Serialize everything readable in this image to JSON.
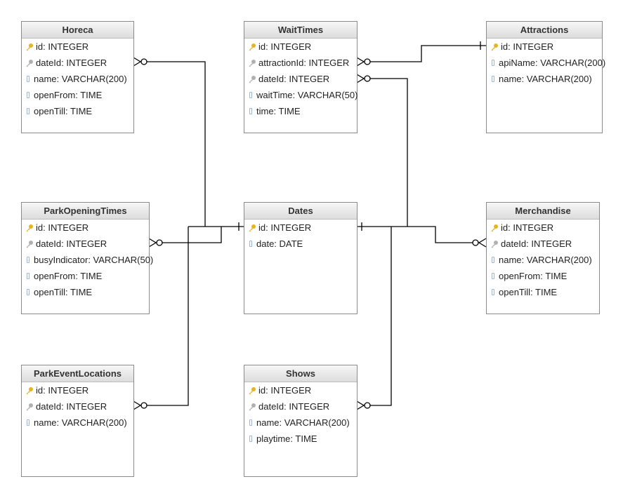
{
  "icons": {
    "pk": "primary-key-icon",
    "fk": "foreign-key-icon",
    "col": "column-icon"
  },
  "colors": {
    "pk": "#e6b422",
    "fk": "#b0b0b0",
    "col": "#9bb7d6",
    "line": "#000000"
  },
  "tables": [
    {
      "id": "horeca",
      "name": "Horeca",
      "fields": [
        {
          "icon": "pk",
          "text": "id: INTEGER"
        },
        {
          "icon": "fk",
          "text": "dateId: INTEGER"
        },
        {
          "icon": "col",
          "text": "name: VARCHAR(200)"
        },
        {
          "icon": "col",
          "text": "openFrom: TIME"
        },
        {
          "icon": "col",
          "text": "openTill: TIME"
        }
      ]
    },
    {
      "id": "waittimes",
      "name": "WaitTimes",
      "fields": [
        {
          "icon": "pk",
          "text": "id: INTEGER"
        },
        {
          "icon": "fk",
          "text": "attractionId: INTEGER"
        },
        {
          "icon": "fk",
          "text": "dateId: INTEGER"
        },
        {
          "icon": "col",
          "text": "waitTime: VARCHAR(50)"
        },
        {
          "icon": "col",
          "text": "time: TIME"
        }
      ]
    },
    {
      "id": "attractions",
      "name": "Attractions",
      "fields": [
        {
          "icon": "pk",
          "text": "id: INTEGER"
        },
        {
          "icon": "col",
          "text": "apiName: VARCHAR(200)"
        },
        {
          "icon": "col",
          "text": "name: VARCHAR(200)"
        }
      ]
    },
    {
      "id": "parkopeningtimes",
      "name": "ParkOpeningTimes",
      "fields": [
        {
          "icon": "pk",
          "text": "id: INTEGER"
        },
        {
          "icon": "fk",
          "text": "dateId: INTEGER"
        },
        {
          "icon": "col",
          "text": "busyIndicator: VARCHAR(50)"
        },
        {
          "icon": "col",
          "text": "openFrom: TIME"
        },
        {
          "icon": "col",
          "text": "openTill: TIME"
        }
      ]
    },
    {
      "id": "dates",
      "name": "Dates",
      "fields": [
        {
          "icon": "pk",
          "text": "id: INTEGER"
        },
        {
          "icon": "col",
          "text": "date: DATE"
        }
      ]
    },
    {
      "id": "merchandise",
      "name": "Merchandise",
      "fields": [
        {
          "icon": "pk",
          "text": "id: INTEGER"
        },
        {
          "icon": "fk",
          "text": "dateId: INTEGER"
        },
        {
          "icon": "col",
          "text": "name: VARCHAR(200)"
        },
        {
          "icon": "col",
          "text": "openFrom: TIME"
        },
        {
          "icon": "col",
          "text": "openTill: TIME"
        }
      ]
    },
    {
      "id": "parkeventlocations",
      "name": "ParkEventLocations",
      "fields": [
        {
          "icon": "pk",
          "text": "id: INTEGER"
        },
        {
          "icon": "fk",
          "text": "dateId: INTEGER"
        },
        {
          "icon": "col",
          "text": "name: VARCHAR(200)"
        }
      ]
    },
    {
      "id": "shows",
      "name": "Shows",
      "fields": [
        {
          "icon": "pk",
          "text": "id: INTEGER"
        },
        {
          "icon": "fk",
          "text": "dateId: INTEGER"
        },
        {
          "icon": "col",
          "text": "name: VARCHAR(200)"
        },
        {
          "icon": "col",
          "text": "playtime: TIME"
        }
      ]
    }
  ],
  "relationships": [
    {
      "from": "Horeca.dateId",
      "to": "Dates.id",
      "type": "many-to-one"
    },
    {
      "from": "ParkOpeningTimes.dateId",
      "to": "Dates.id",
      "type": "many-to-one"
    },
    {
      "from": "ParkEventLocations.dateId",
      "to": "Dates.id",
      "type": "many-to-one"
    },
    {
      "from": "WaitTimes.attractionId",
      "to": "Attractions.id",
      "type": "many-to-one"
    },
    {
      "from": "WaitTimes.dateId",
      "to": "Dates.id",
      "type": "many-to-one"
    },
    {
      "from": "Merchandise.dateId",
      "to": "Dates.id",
      "type": "many-to-one"
    },
    {
      "from": "Shows.dateId",
      "to": "Dates.id",
      "type": "many-to-one"
    }
  ]
}
